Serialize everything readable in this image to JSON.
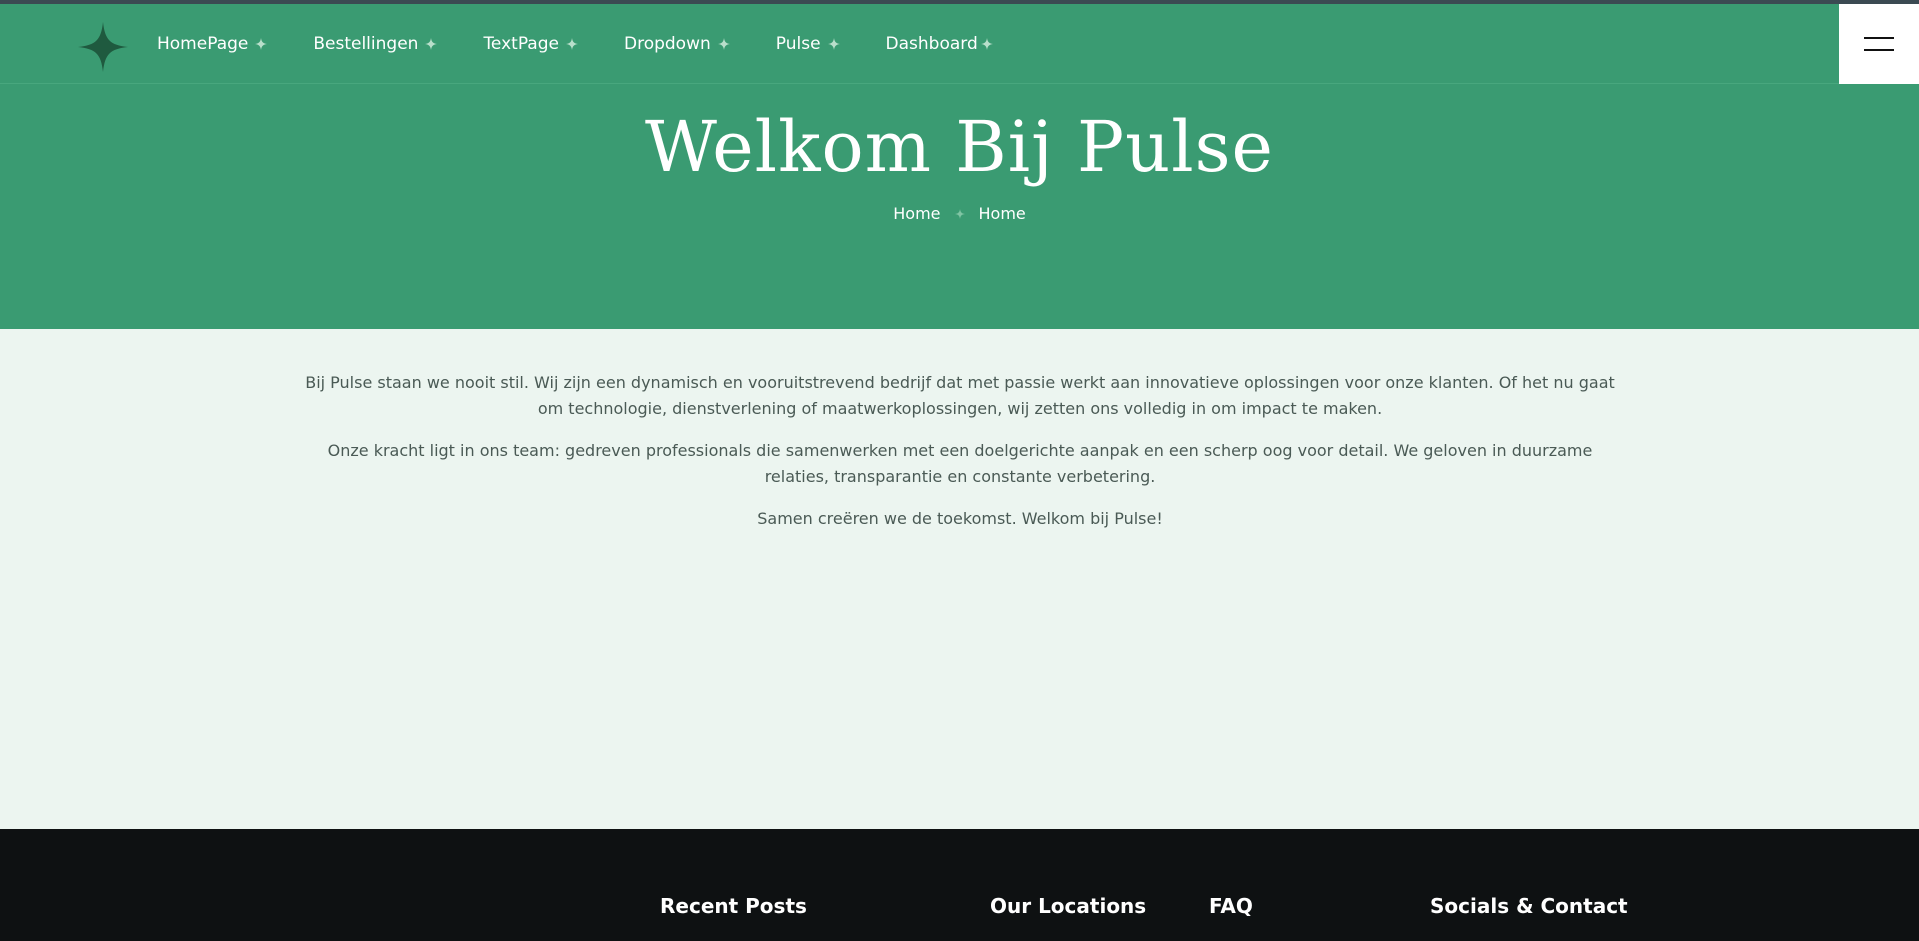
{
  "nav": {
    "logo_icon": "four-point-star-icon",
    "items": [
      {
        "label": "HomePage"
      },
      {
        "label": "Bestellingen"
      },
      {
        "label": "TextPage"
      },
      {
        "label": "Dropdown"
      },
      {
        "label": "Pulse"
      },
      {
        "label": "Dashboard"
      }
    ],
    "menu_icon": "hamburger-menu-icon"
  },
  "hero": {
    "title": "Welkom Bij Pulse",
    "breadcrumb": [
      "Home",
      "Home"
    ]
  },
  "content": {
    "paragraphs": [
      "Bij Pulse staan we nooit stil. Wij zijn een dynamisch en vooruitstrevend bedrijf dat met passie werkt aan innovatieve oplossingen voor onze klanten. Of het nu gaat om technologie, dienstverlening of maatwerkoplossingen, wij zetten ons volledig in om impact te maken.",
      "Onze kracht ligt in ons team: gedreven professionals die samenwerken met een doelgerichte aanpak en een scherp oog voor detail. We geloven in duurzame relaties, transparantie en constante verbetering.",
      "Samen creëren we de toekomst. Welkom bij Pulse!"
    ]
  },
  "footer": {
    "headings": [
      "Recent Posts",
      "Our Locations",
      "FAQ",
      "Socials & Contact"
    ]
  },
  "colors": {
    "brand_green": "#3a9b72",
    "logo_green": "#1f5a3f",
    "footer_bg": "#0e1112",
    "content_bg": "#ecf5f0"
  }
}
